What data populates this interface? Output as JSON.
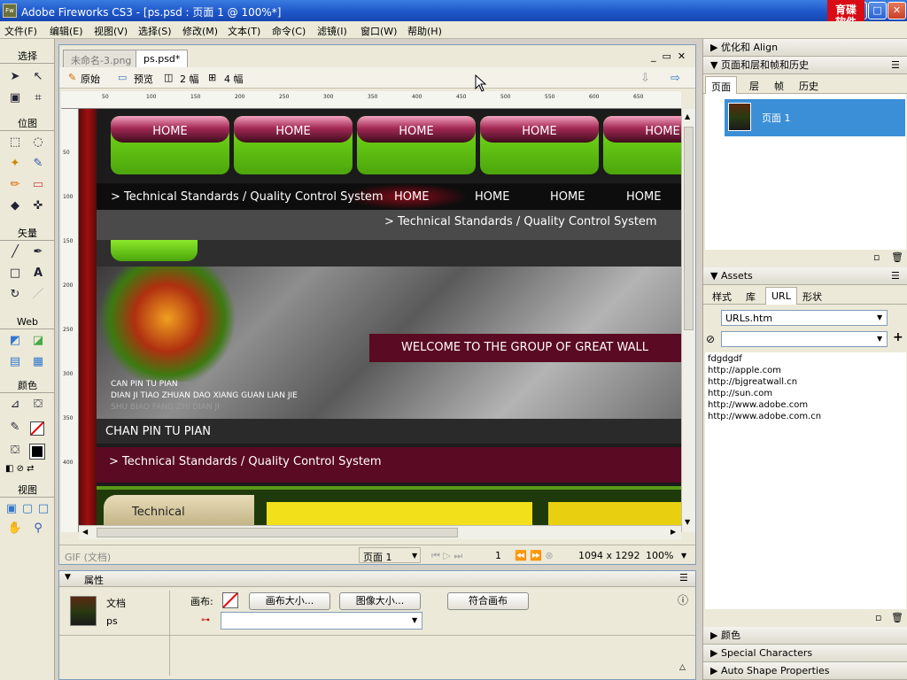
{
  "app": {
    "title": "Adobe Fireworks CS3 - [ps.psd : 页面 1 @ 100%*]",
    "icon": "Fw",
    "logo_text_line1": "育碟",
    "logo_text_line2": "软件"
  },
  "menu": [
    "文件(F)",
    "编辑(E)",
    "视图(V)",
    "选择(S)",
    "修改(M)",
    "文本(T)",
    "命令(C)",
    "滤镜(I)",
    "窗口(W)",
    "帮助(H)"
  ],
  "tools": {
    "sections": [
      "选择",
      "位图",
      "矢量",
      "Web",
      "颜色",
      "视图"
    ]
  },
  "document": {
    "tabs": [
      "未命名-3.png",
      "ps.psd*"
    ],
    "views": [
      "原始",
      "预览",
      "2 幅",
      "4 幅"
    ],
    "ruler_h": [
      "50",
      "100",
      "150",
      "200",
      "250",
      "300",
      "350",
      "400",
      "450",
      "500",
      "550",
      "600",
      "650"
    ],
    "ruler_v": [
      "50",
      "100",
      "150",
      "200",
      "250",
      "300",
      "350",
      "400"
    ],
    "canvas": {
      "home_buttons": [
        "HOME",
        "HOME",
        "HOME",
        "HOME",
        "HOME"
      ],
      "strip1_text": "> Technical Standards / Quality Control System",
      "strip1_links": [
        "HOME",
        "HOME",
        "HOME",
        "HOME"
      ],
      "strip2_text": "> Technical Standards / Quality Control System",
      "banner_welcome": "WELCOME TO THE GROUP OF GREAT WALL",
      "banner_line1": "CAN PIN TU PIAN",
      "banner_line2": "DIAN JI TIAO ZHUAN DAO XIANG GUAN LIAN JIE",
      "banner_line3": "SHU BIAO FANG ZHI DIAN JI",
      "section_title": "CHAN PIN TU PIAN",
      "strip3_text": "> Technical Standards / Quality Control System",
      "bottom_label": "Technical"
    },
    "status": {
      "format": "GIF (文档)",
      "page": "页面 1",
      "frame": "1",
      "size": "1094 x 1292",
      "zoom": "100%"
    }
  },
  "properties": {
    "title": "属性",
    "doc_label": "文档",
    "doc_name": "ps",
    "canvas_label": "画布:",
    "buttons": [
      "画布大小...",
      "图像大小...",
      "符合画布"
    ]
  },
  "panels": {
    "optimize": "优化和 Align",
    "pages_title": "页面和层和帧和历史",
    "pages_tabs": [
      "页面",
      "层",
      "帧",
      "历史"
    ],
    "page_item": "页面 1",
    "assets_title": "Assets",
    "assets_tabs": [
      "样式",
      "库",
      "URL",
      "形状"
    ],
    "url_file": "URLs.htm",
    "url_input": "",
    "urls": [
      "fdgdgdf",
      "http://apple.com",
      "http://bjgreatwall.cn",
      "http://sun.com",
      "http://www.adobe.com",
      "http://www.adobe.com.cn"
    ],
    "collapsed": [
      "颜色",
      "Special Characters",
      "Auto Shape Properties"
    ]
  },
  "colors": {
    "accent": "#3a7be0",
    "selected": "#3b8fd6",
    "maroon": "#5a0a22",
    "green": "#7be31b"
  }
}
